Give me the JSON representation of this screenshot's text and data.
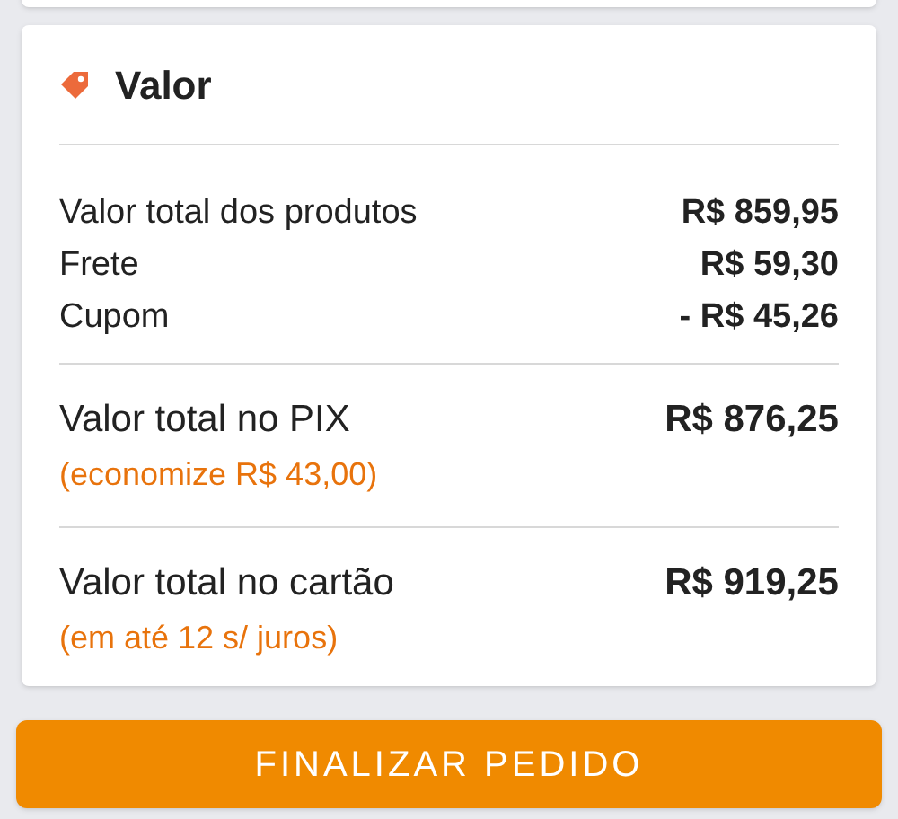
{
  "section": {
    "title": "Valor"
  },
  "lines": [
    {
      "label": "Valor total dos produtos",
      "value": "R$ 859,95"
    },
    {
      "label": "Frete",
      "value": "R$ 59,30"
    },
    {
      "label": "Cupom",
      "value": "- R$ 45,26"
    }
  ],
  "totals": [
    {
      "label": "Valor total no PIX",
      "value": "R$ 876,25",
      "note": "(economize R$ 43,00)"
    },
    {
      "label": "Valor total no cartão",
      "value": "R$ 919,25",
      "note": "(em até 12 s/ juros)"
    }
  ],
  "button": "FINALIZAR PEDIDO"
}
